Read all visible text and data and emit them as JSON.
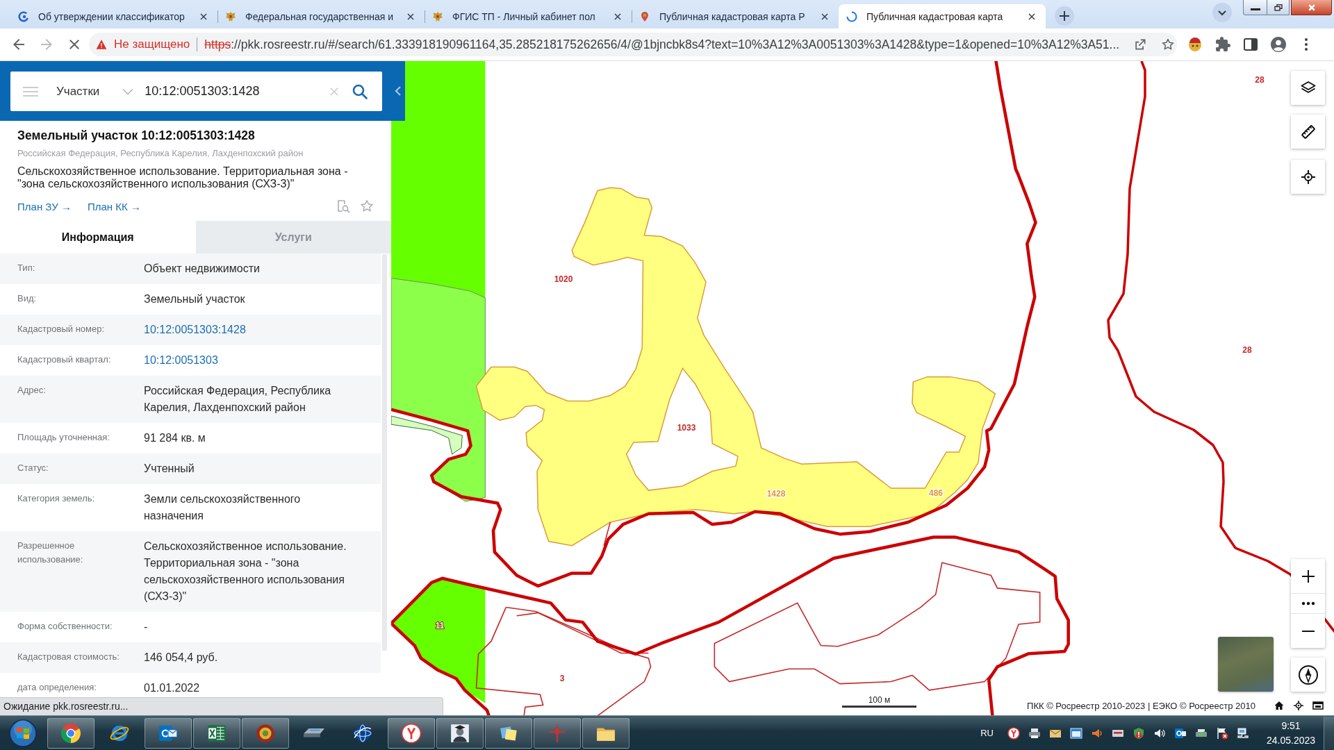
{
  "browser_tabs": [
    {
      "title": "Об утверждении классификатор",
      "selected": false
    },
    {
      "title": "Федеральная государственная и",
      "selected": false
    },
    {
      "title": "ФГИС ТП - Личный кабинет пол",
      "selected": false
    },
    {
      "title": "Публичная кадастровая карта Р",
      "selected": false
    },
    {
      "title": "Публичная кадастровая карта",
      "selected": true
    }
  ],
  "toolbar": {
    "loading": true,
    "forward_disabled": true
  },
  "address_bar": {
    "secure": false,
    "security_label": "Не защищено",
    "scheme": "https",
    "rest": "://pkk.rosreestr.ru/#/search/61.333918190961164,35.285218175262656/4/@1bjncbk8s4?text=10%3A12%3A0051303%3A1428&type=1&opened=10%3A12%3A51..."
  },
  "search": {
    "layer": "Участки",
    "value": "10:12:0051303:1428"
  },
  "card": {
    "title": "Земельный участок 10:12:0051303:1428",
    "address": "Российская Федерация, Республика Карелия, Лахденпохский район",
    "description": "Сельскохозяйственное использование. Территориальная зона - \"зона сельскохозяйственного использования (СХЗ-3)\"",
    "links": [
      "План ЗУ →",
      "План КК →"
    ]
  },
  "info_tabs": [
    {
      "label": "Информация",
      "selected": true
    },
    {
      "label": "Услуги",
      "selected": false
    }
  ],
  "info_rows": [
    {
      "label": "Тип:",
      "value": "Объект недвижимости",
      "kind": "text"
    },
    {
      "label": "Вид:",
      "value": "Земельный участок",
      "kind": "text"
    },
    {
      "label": "Кадастровый номер:",
      "value": "10:12:0051303:1428",
      "kind": "link"
    },
    {
      "label": "Кадастровый квартал:",
      "value": "10:12:0051303",
      "kind": "link"
    },
    {
      "label": "Адрес:",
      "value": "Российская Федерация, Республика Карелия, Лахденпохский район",
      "kind": "text"
    },
    {
      "label": "Площадь уточненная:",
      "value": "91 284 кв. м",
      "kind": "text"
    },
    {
      "label": "Статус:",
      "value": "Учтенный",
      "kind": "text"
    },
    {
      "label": "Категория земель:",
      "value": "Земли сельскохозяйственного назначения",
      "kind": "text"
    },
    {
      "label": "Разрешенное использование:",
      "value": "Сельскохозяйственное использование. Территориальная зона - \"зона сельскохозяйственного использования (СХЗ-3)\"",
      "kind": "text"
    },
    {
      "label": "Форма собственности:",
      "value": "-",
      "kind": "text"
    },
    {
      "label": "Кадастровая стоимость:",
      "value": "146 054,4 руб.",
      "kind": "text"
    },
    {
      "label": "дата определения:",
      "value": "01.01.2022",
      "kind": "text"
    }
  ],
  "status_text": "Ожидание pkk.rosreestr.ru...",
  "map": {
    "labels": [
      {
        "text": "28",
        "kind": "parcel"
      },
      {
        "text": "1020",
        "kind": "parcel"
      },
      {
        "text": "28",
        "kind": "parcel"
      },
      {
        "text": "1033",
        "kind": "parcel"
      },
      {
        "text": "1428",
        "kind": "selected"
      },
      {
        "text": "486",
        "kind": "selected"
      },
      {
        "text": "11",
        "kind": "on-fill"
      },
      {
        "text": "3",
        "kind": "parcel"
      }
    ],
    "scale": "100 м",
    "attribution": "ПКК © Росреестр 2010-2023 | ЕЭКО © Росреестр 2010"
  },
  "taskbar": {
    "apps": [
      {
        "running": true
      },
      {
        "running": false
      },
      {
        "running": true
      },
      {
        "running": true
      },
      {
        "running": true
      },
      {
        "running": false
      },
      {
        "running": false
      },
      {
        "running": true
      },
      {
        "running": true
      },
      {
        "running": true
      },
      {
        "running": true
      },
      {
        "running": true
      }
    ],
    "language": "RU",
    "time": "9:51",
    "date": "24.05.2023"
  }
}
